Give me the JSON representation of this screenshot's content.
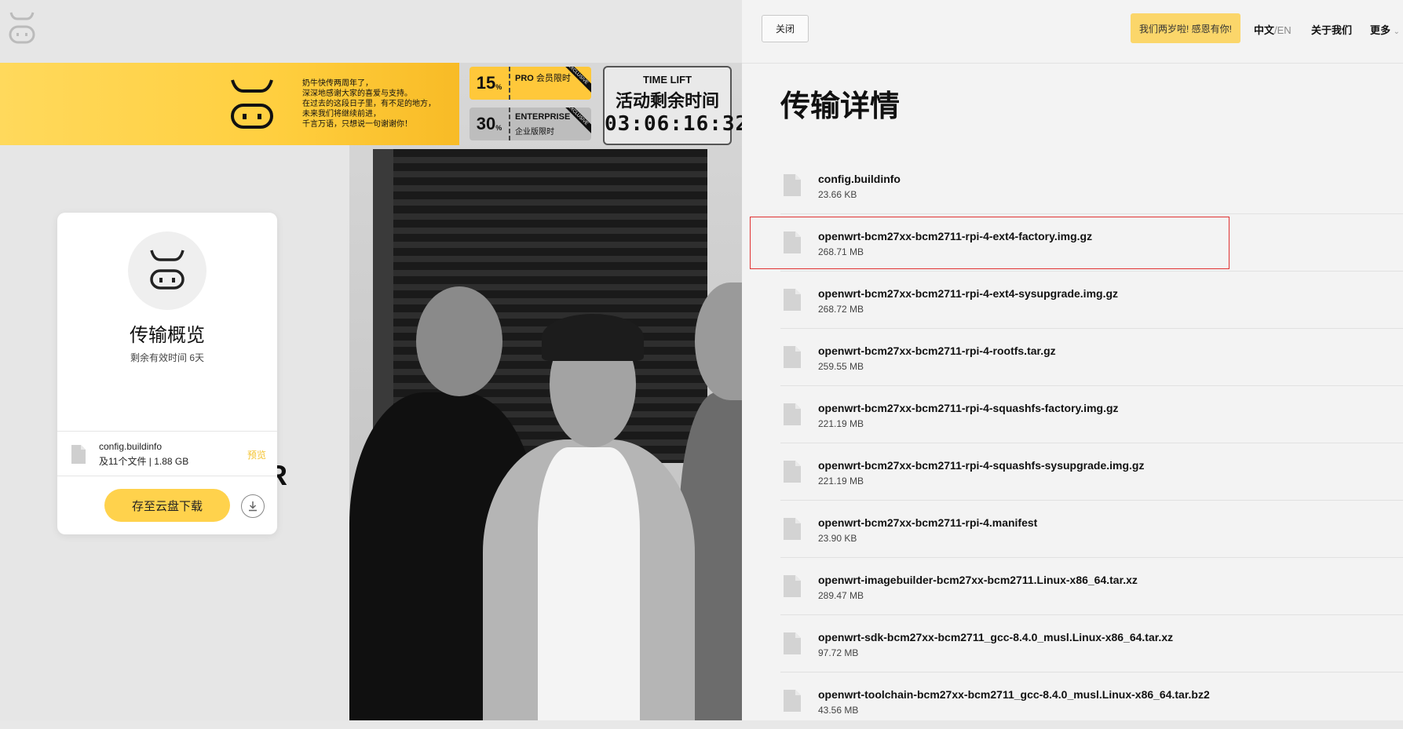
{
  "banner": {
    "lines": [
      "奶牛快传两周年了，",
      "深深地感谢大家的喜爱与支持。",
      "在过去的这段日子里，有不足的地方，",
      "未来我们将继续前进，",
      "千言万语，只想说一句谢谢你！"
    ],
    "coupon_pro": {
      "percent": "15",
      "unit": "%",
      "title": "PRO",
      "subtitle": "会员限时"
    },
    "coupon_enterprise": {
      "percent": "30",
      "unit": "%",
      "title": "ENTERPRISE",
      "subtitle": "企业版限时"
    },
    "timer": {
      "title": "TIME LIFT",
      "label": "活动剩余时间",
      "value": "03:06:16:32"
    }
  },
  "background_letter": "R",
  "card": {
    "title": "传输概览",
    "subtitle": "剩余有效时间 6天",
    "file_name": "config.buildinfo",
    "file_meta": "及11个文件 | 1.88 GB",
    "preview_label": "预览",
    "save_button": "存至云盘下载"
  },
  "header": {
    "close_label": "关闭",
    "promo_label": "我们两岁啦! 感恩有你!",
    "lang_zh": "中文",
    "lang_sep": "/",
    "lang_en": "EN",
    "about_label": "关于我们",
    "more_label": "更多"
  },
  "panel_title": "传输详情",
  "files": [
    {
      "name": "config.buildinfo",
      "size": "23.66 KB"
    },
    {
      "name": "openwrt-bcm27xx-bcm2711-rpi-4-ext4-factory.img.gz",
      "size": "268.71 MB"
    },
    {
      "name": "openwrt-bcm27xx-bcm2711-rpi-4-ext4-sysupgrade.img.gz",
      "size": "268.72 MB"
    },
    {
      "name": "openwrt-bcm27xx-bcm2711-rpi-4-rootfs.tar.gz",
      "size": "259.55 MB"
    },
    {
      "name": "openwrt-bcm27xx-bcm2711-rpi-4-squashfs-factory.img.gz",
      "size": "221.19 MB"
    },
    {
      "name": "openwrt-bcm27xx-bcm2711-rpi-4-squashfs-sysupgrade.img.gz",
      "size": "221.19 MB"
    },
    {
      "name": "openwrt-bcm27xx-bcm2711-rpi-4.manifest",
      "size": "23.90 KB"
    },
    {
      "name": "openwrt-imagebuilder-bcm27xx-bcm2711.Linux-x86_64.tar.xz",
      "size": "289.47 MB"
    },
    {
      "name": "openwrt-sdk-bcm27xx-bcm2711_gcc-8.4.0_musl.Linux-x86_64.tar.xz",
      "size": "97.72 MB"
    },
    {
      "name": "openwrt-toolchain-bcm27xx-bcm2711_gcc-8.4.0_musl.Linux-x86_64.tar.bz2",
      "size": "43.56 MB"
    }
  ],
  "highlighted_file_index": 1,
  "colors": {
    "accent_yellow": "#ffd24c",
    "highlight_border": "#e03131"
  },
  "icons": [
    "cow-logo-icon",
    "file-icon",
    "download-icon"
  ]
}
